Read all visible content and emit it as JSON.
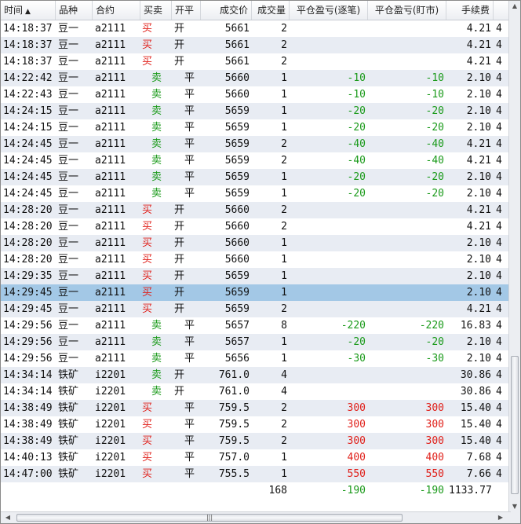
{
  "columns": [
    {
      "key": "time",
      "label": "时间",
      "sort": "▲"
    },
    {
      "key": "product",
      "label": "品种"
    },
    {
      "key": "contract",
      "label": "合约"
    },
    {
      "key": "side",
      "label": "买卖"
    },
    {
      "key": "oc",
      "label": "开平"
    },
    {
      "key": "price",
      "label": "成交价"
    },
    {
      "key": "qty",
      "label": "成交量"
    },
    {
      "key": "pnl_trade",
      "label": "平仓盈亏(逐笔)"
    },
    {
      "key": "pnl_mtm",
      "label": "平仓盈亏(盯市)"
    },
    {
      "key": "fee",
      "label": "手续费"
    },
    {
      "key": "extra",
      "label": ""
    }
  ],
  "rows": [
    {
      "time": "14:18:37",
      "product": "豆一",
      "contract": "a2111",
      "side": "买",
      "oc": "开",
      "price": "5661",
      "qty": "2",
      "pnl_trade": "",
      "pnl_mtm": "",
      "fee": "4.21",
      "extra": "4"
    },
    {
      "time": "14:18:37",
      "product": "豆一",
      "contract": "a2111",
      "side": "买",
      "oc": "开",
      "price": "5661",
      "qty": "2",
      "pnl_trade": "",
      "pnl_mtm": "",
      "fee": "4.21",
      "extra": "4"
    },
    {
      "time": "14:18:37",
      "product": "豆一",
      "contract": "a2111",
      "side": "买",
      "oc": "开",
      "price": "5661",
      "qty": "2",
      "pnl_trade": "",
      "pnl_mtm": "",
      "fee": "4.21",
      "extra": "4"
    },
    {
      "time": "14:22:42",
      "product": "豆一",
      "contract": "a2111",
      "side": "卖",
      "oc": "平",
      "price": "5660",
      "qty": "1",
      "pnl_trade": "-10",
      "pnl_mtm": "-10",
      "fee": "2.10",
      "extra": "4"
    },
    {
      "time": "14:22:43",
      "product": "豆一",
      "contract": "a2111",
      "side": "卖",
      "oc": "平",
      "price": "5660",
      "qty": "1",
      "pnl_trade": "-10",
      "pnl_mtm": "-10",
      "fee": "2.10",
      "extra": "4"
    },
    {
      "time": "14:24:15",
      "product": "豆一",
      "contract": "a2111",
      "side": "卖",
      "oc": "平",
      "price": "5659",
      "qty": "1",
      "pnl_trade": "-20",
      "pnl_mtm": "-20",
      "fee": "2.10",
      "extra": "4"
    },
    {
      "time": "14:24:15",
      "product": "豆一",
      "contract": "a2111",
      "side": "卖",
      "oc": "平",
      "price": "5659",
      "qty": "1",
      "pnl_trade": "-20",
      "pnl_mtm": "-20",
      "fee": "2.10",
      "extra": "4"
    },
    {
      "time": "14:24:45",
      "product": "豆一",
      "contract": "a2111",
      "side": "卖",
      "oc": "平",
      "price": "5659",
      "qty": "2",
      "pnl_trade": "-40",
      "pnl_mtm": "-40",
      "fee": "4.21",
      "extra": "4"
    },
    {
      "time": "14:24:45",
      "product": "豆一",
      "contract": "a2111",
      "side": "卖",
      "oc": "平",
      "price": "5659",
      "qty": "2",
      "pnl_trade": "-40",
      "pnl_mtm": "-40",
      "fee": "4.21",
      "extra": "4"
    },
    {
      "time": "14:24:45",
      "product": "豆一",
      "contract": "a2111",
      "side": "卖",
      "oc": "平",
      "price": "5659",
      "qty": "1",
      "pnl_trade": "-20",
      "pnl_mtm": "-20",
      "fee": "2.10",
      "extra": "4"
    },
    {
      "time": "14:24:45",
      "product": "豆一",
      "contract": "a2111",
      "side": "卖",
      "oc": "平",
      "price": "5659",
      "qty": "1",
      "pnl_trade": "-20",
      "pnl_mtm": "-20",
      "fee": "2.10",
      "extra": "4"
    },
    {
      "time": "14:28:20",
      "product": "豆一",
      "contract": "a2111",
      "side": "买",
      "oc": "开",
      "price": "5660",
      "qty": "2",
      "pnl_trade": "",
      "pnl_mtm": "",
      "fee": "4.21",
      "extra": "4"
    },
    {
      "time": "14:28:20",
      "product": "豆一",
      "contract": "a2111",
      "side": "买",
      "oc": "开",
      "price": "5660",
      "qty": "2",
      "pnl_trade": "",
      "pnl_mtm": "",
      "fee": "4.21",
      "extra": "4"
    },
    {
      "time": "14:28:20",
      "product": "豆一",
      "contract": "a2111",
      "side": "买",
      "oc": "开",
      "price": "5660",
      "qty": "1",
      "pnl_trade": "",
      "pnl_mtm": "",
      "fee": "2.10",
      "extra": "4"
    },
    {
      "time": "14:28:20",
      "product": "豆一",
      "contract": "a2111",
      "side": "买",
      "oc": "开",
      "price": "5660",
      "qty": "1",
      "pnl_trade": "",
      "pnl_mtm": "",
      "fee": "2.10",
      "extra": "4"
    },
    {
      "time": "14:29:35",
      "product": "豆一",
      "contract": "a2111",
      "side": "买",
      "oc": "开",
      "price": "5659",
      "qty": "1",
      "pnl_trade": "",
      "pnl_mtm": "",
      "fee": "2.10",
      "extra": "4"
    },
    {
      "time": "14:29:45",
      "product": "豆一",
      "contract": "a2111",
      "side": "买",
      "oc": "开",
      "price": "5659",
      "qty": "1",
      "pnl_trade": "",
      "pnl_mtm": "",
      "fee": "2.10",
      "extra": "4",
      "selected": true
    },
    {
      "time": "14:29:45",
      "product": "豆一",
      "contract": "a2111",
      "side": "买",
      "oc": "开",
      "price": "5659",
      "qty": "2",
      "pnl_trade": "",
      "pnl_mtm": "",
      "fee": "4.21",
      "extra": "4"
    },
    {
      "time": "14:29:56",
      "product": "豆一",
      "contract": "a2111",
      "side": "卖",
      "oc": "平",
      "price": "5657",
      "qty": "8",
      "pnl_trade": "-220",
      "pnl_mtm": "-220",
      "fee": "16.83",
      "extra": "4"
    },
    {
      "time": "14:29:56",
      "product": "豆一",
      "contract": "a2111",
      "side": "卖",
      "oc": "平",
      "price": "5657",
      "qty": "1",
      "pnl_trade": "-20",
      "pnl_mtm": "-20",
      "fee": "2.10",
      "extra": "4"
    },
    {
      "time": "14:29:56",
      "product": "豆一",
      "contract": "a2111",
      "side": "卖",
      "oc": "平",
      "price": "5656",
      "qty": "1",
      "pnl_trade": "-30",
      "pnl_mtm": "-30",
      "fee": "2.10",
      "extra": "4"
    },
    {
      "time": "14:34:14",
      "product": "铁矿",
      "contract": "i2201",
      "side": "卖",
      "oc": "开",
      "price": "761.0",
      "qty": "4",
      "pnl_trade": "",
      "pnl_mtm": "",
      "fee": "30.86",
      "extra": "4"
    },
    {
      "time": "14:34:14",
      "product": "铁矿",
      "contract": "i2201",
      "side": "卖",
      "oc": "开",
      "price": "761.0",
      "qty": "4",
      "pnl_trade": "",
      "pnl_mtm": "",
      "fee": "30.86",
      "extra": "4"
    },
    {
      "time": "14:38:49",
      "product": "铁矿",
      "contract": "i2201",
      "side": "买",
      "oc": "平",
      "price": "759.5",
      "qty": "2",
      "pnl_trade": "300",
      "pnl_mtm": "300",
      "fee": "15.40",
      "extra": "4"
    },
    {
      "time": "14:38:49",
      "product": "铁矿",
      "contract": "i2201",
      "side": "买",
      "oc": "平",
      "price": "759.5",
      "qty": "2",
      "pnl_trade": "300",
      "pnl_mtm": "300",
      "fee": "15.40",
      "extra": "4"
    },
    {
      "time": "14:38:49",
      "product": "铁矿",
      "contract": "i2201",
      "side": "买",
      "oc": "平",
      "price": "759.5",
      "qty": "2",
      "pnl_trade": "300",
      "pnl_mtm": "300",
      "fee": "15.40",
      "extra": "4"
    },
    {
      "time": "14:40:13",
      "product": "铁矿",
      "contract": "i2201",
      "side": "买",
      "oc": "平",
      "price": "757.0",
      "qty": "1",
      "pnl_trade": "400",
      "pnl_mtm": "400",
      "fee": "7.68",
      "extra": "4"
    },
    {
      "time": "14:47:00",
      "product": "铁矿",
      "contract": "i2201",
      "side": "买",
      "oc": "平",
      "price": "755.5",
      "qty": "1",
      "pnl_trade": "550",
      "pnl_mtm": "550",
      "fee": "7.66",
      "extra": "4"
    }
  ],
  "totals": {
    "qty": "168",
    "pnl_trade": "-190",
    "pnl_mtm": "-190",
    "fee": "1133.77"
  },
  "colors": {
    "buy": "#e0201a",
    "sell": "#1a9a1a",
    "profit": "#e0201a",
    "loss": "#1a9a1a",
    "selected": "#a3c8e6"
  },
  "icons": {
    "vscroll_up": "triangle-up-icon",
    "vscroll_down": "triangle-down-icon",
    "hscroll_left": "triangle-left-icon",
    "hscroll_right": "triangle-right-icon",
    "hscroll_grip": "grip-icon"
  }
}
